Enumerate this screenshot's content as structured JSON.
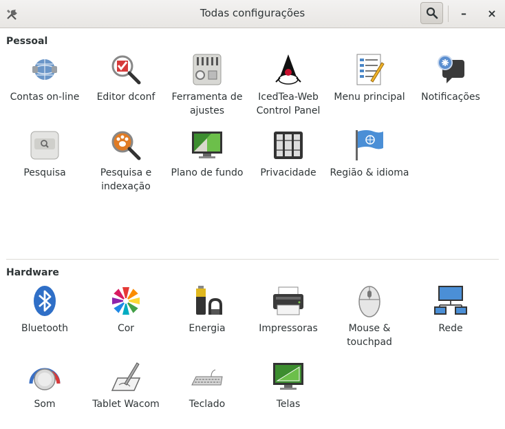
{
  "window": {
    "title": "Todas configurações",
    "minimize_glyph": "–",
    "close_glyph": "×"
  },
  "sections": {
    "pessoal": {
      "title": "Pessoal",
      "items": [
        {
          "label": "Contas on-line",
          "icon": "online-accounts-icon"
        },
        {
          "label": "Editor dconf",
          "icon": "dconf-editor-icon"
        },
        {
          "label": "Ferramenta de ajustes",
          "icon": "tweak-tool-icon"
        },
        {
          "label": "IcedTea-Web Control Panel",
          "icon": "icedtea-icon"
        },
        {
          "label": "Menu principal",
          "icon": "main-menu-icon"
        },
        {
          "label": "Notificações",
          "icon": "notifications-icon"
        },
        {
          "label": "Pesquisa",
          "icon": "search-settings-icon"
        },
        {
          "label": "Pesquisa e indexação",
          "icon": "search-indexing-icon"
        },
        {
          "label": "Plano de fundo",
          "icon": "background-icon"
        },
        {
          "label": "Privacidade",
          "icon": "privacy-icon"
        },
        {
          "label": "Região & idioma",
          "icon": "region-language-icon"
        }
      ]
    },
    "hardware": {
      "title": "Hardware",
      "items": [
        {
          "label": "Bluetooth",
          "icon": "bluetooth-icon"
        },
        {
          "label": "Cor",
          "icon": "color-icon"
        },
        {
          "label": "Energia",
          "icon": "power-icon"
        },
        {
          "label": "Impressoras",
          "icon": "printer-icon"
        },
        {
          "label": "Mouse & touchpad",
          "icon": "mouse-icon"
        },
        {
          "label": "Rede",
          "icon": "network-icon"
        },
        {
          "label": "Som",
          "icon": "sound-icon"
        },
        {
          "label": "Tablet Wacom",
          "icon": "wacom-tablet-icon"
        },
        {
          "label": "Teclado",
          "icon": "keyboard-icon"
        },
        {
          "label": "Telas",
          "icon": "displays-icon"
        }
      ]
    }
  }
}
